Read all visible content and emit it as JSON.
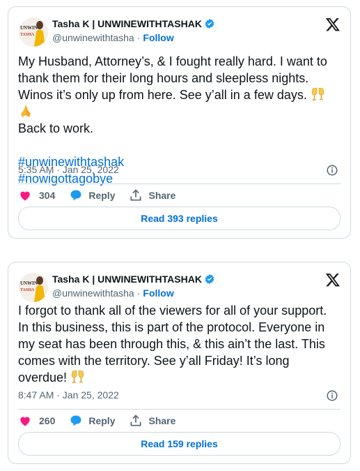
{
  "tweets": [
    {
      "author_name": "Tasha K | UNWINEWITHTASHAK",
      "handle": "@unwinewithtasha",
      "dot": "·",
      "follow_label": "Follow",
      "text": "My Husband, Attorney’s, & I fought really hard. I want to thank them for their long hours and sleepless nights. Winos it’s only up from here. See y’all in a few days.",
      "text_tail": "Back to work.",
      "emojis": [
        "clinking-glasses",
        "folded-hands"
      ],
      "hashtags": [
        "#unwinewithtashak",
        "#nowigottagobye"
      ],
      "timestamp": "5:35 AM · Jan 25, 2022",
      "likes": "304",
      "reply_label": "Reply",
      "share_label": "Share",
      "read_replies_label": "Read 393 replies"
    },
    {
      "author_name": "Tasha K | UNWINEWITHTASHAK",
      "handle": "@unwinewithtasha",
      "dot": "·",
      "follow_label": "Follow",
      "text": "I forgot to thank all of the viewers for all of your support. In this business, this is part of the protocol. Everyone in my seat has been through this, & this ain’t the last. This comes with the territory. See y’all Friday! It’s long overdue!",
      "emojis": [
        "clinking-glasses"
      ],
      "timestamp": "8:47 AM · Jan 25, 2022",
      "likes": "260",
      "reply_label": "Reply",
      "share_label": "Share",
      "read_replies_label": "Read 159 replies"
    }
  ],
  "colors": {
    "link": "#006fd6",
    "heart": "#f91880",
    "reply_icon": "#1d9bf0",
    "verified": "#1d9bf0",
    "border": "#cfd9de",
    "muted": "#536471"
  }
}
